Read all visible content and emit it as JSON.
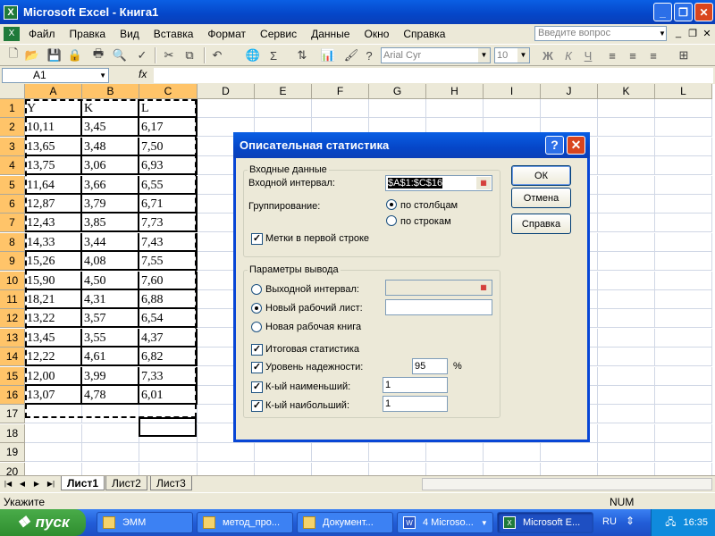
{
  "window": {
    "title": "Microsoft Excel - Книга1",
    "icon": "excel-app-icon"
  },
  "menu": [
    "Файл",
    "Правка",
    "Вид",
    "Вставка",
    "Формат",
    "Сервис",
    "Данные",
    "Окно",
    "Справка"
  ],
  "help_box": {
    "placeholder": "Введите вопрос"
  },
  "toolbar": {
    "font": "Arial Cyr",
    "size": "10",
    "bold": "Ж",
    "italic": "К",
    "underline": "Ч"
  },
  "formula_bar": {
    "name_box": "A1",
    "fx": "fx",
    "content": ""
  },
  "sheet": {
    "columns": [
      "A",
      "B",
      "C",
      "D",
      "E",
      "F",
      "G",
      "H",
      "I",
      "J",
      "K",
      "L"
    ],
    "rows": [
      "1",
      "2",
      "3",
      "4",
      "5",
      "6",
      "7",
      "8",
      "9",
      "10",
      "11",
      "12",
      "13",
      "14",
      "15",
      "16",
      "17",
      "18",
      "19",
      "20"
    ],
    "header": [
      "Y",
      "K",
      "L"
    ],
    "data": [
      [
        "10,11",
        "3,45",
        "6,17"
      ],
      [
        "13,65",
        "3,48",
        "7,50"
      ],
      [
        "13,75",
        "3,06",
        "6,93"
      ],
      [
        "11,64",
        "3,66",
        "6,55"
      ],
      [
        "12,87",
        "3,79",
        "6,71"
      ],
      [
        "12,43",
        "3,85",
        "7,73"
      ],
      [
        "14,33",
        "3,44",
        "7,43"
      ],
      [
        "15,26",
        "4,08",
        "7,55"
      ],
      [
        "15,90",
        "4,50",
        "7,60"
      ],
      [
        "18,21",
        "4,31",
        "6,88"
      ],
      [
        "13,22",
        "3,57",
        "6,54"
      ],
      [
        "13,45",
        "3,55",
        "4,37"
      ],
      [
        "12,22",
        "4,61",
        "6,82"
      ],
      [
        "12,00",
        "3,99",
        "7,33"
      ],
      [
        "13,07",
        "4,78",
        "6,01"
      ]
    ],
    "tabs": [
      "Лист1",
      "Лист2",
      "Лист3"
    ],
    "active_tab": "Лист1"
  },
  "status": {
    "left": "Укажите",
    "num": "NUM"
  },
  "dialog": {
    "title": "Описательная статистика",
    "input_group": "Входные данные",
    "input_range_label": "Входной интервал:",
    "input_range_value": "$A$1:$C$16",
    "grouping_label": "Группирование:",
    "by_columns": "по столбцам",
    "by_rows": "по строкам",
    "labels_first_row": "Метки в первой строке",
    "output_group": "Параметры вывода",
    "output_range": "Выходной интервал:",
    "new_sheet": "Новый рабочий лист:",
    "new_book": "Новая рабочая книга",
    "summary_stats": "Итоговая статистика",
    "confidence": "Уровень надежности:",
    "confidence_value": "95",
    "percent": "%",
    "kth_smallest": "К-ый наименьший:",
    "kth_smallest_value": "1",
    "kth_largest": "К-ый наибольший:",
    "kth_largest_value": "1",
    "ok": "ОК",
    "cancel": "Отмена",
    "help": "Справка"
  },
  "taskbar": {
    "start": "пуск",
    "tasks": [
      "ЭММ",
      "метод_про...",
      "Документ...",
      "4 Microso...",
      "Microsoft E..."
    ],
    "lang": "RU",
    "clock": "16:35"
  }
}
